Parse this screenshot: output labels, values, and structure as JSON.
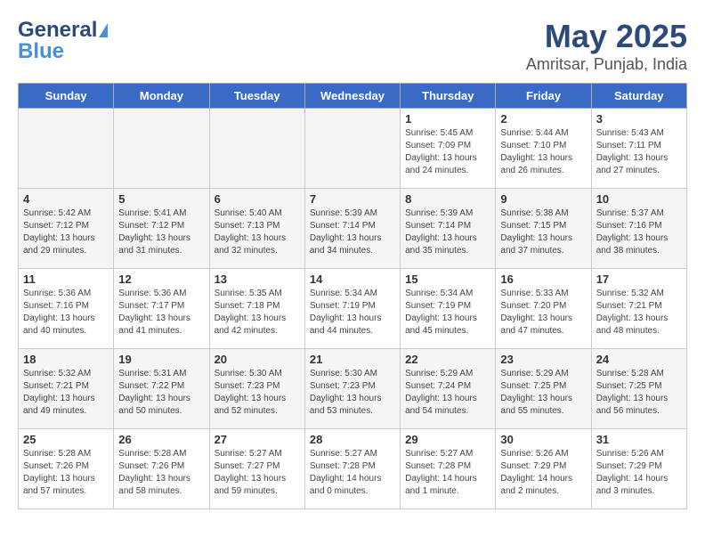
{
  "header": {
    "logo_general": "General",
    "logo_blue": "Blue",
    "title": "May 2025",
    "subtitle": "Amritsar, Punjab, India"
  },
  "days_of_week": [
    "Sunday",
    "Monday",
    "Tuesday",
    "Wednesday",
    "Thursday",
    "Friday",
    "Saturday"
  ],
  "weeks": [
    [
      {
        "day": "",
        "empty": true
      },
      {
        "day": "",
        "empty": true
      },
      {
        "day": "",
        "empty": true
      },
      {
        "day": "",
        "empty": true
      },
      {
        "day": "1",
        "sunrise": "5:45 AM",
        "sunset": "7:09 PM",
        "daylight": "13 hours and 24 minutes."
      },
      {
        "day": "2",
        "sunrise": "5:44 AM",
        "sunset": "7:10 PM",
        "daylight": "13 hours and 26 minutes."
      },
      {
        "day": "3",
        "sunrise": "5:43 AM",
        "sunset": "7:11 PM",
        "daylight": "13 hours and 27 minutes."
      }
    ],
    [
      {
        "day": "4",
        "sunrise": "5:42 AM",
        "sunset": "7:12 PM",
        "daylight": "13 hours and 29 minutes."
      },
      {
        "day": "5",
        "sunrise": "5:41 AM",
        "sunset": "7:12 PM",
        "daylight": "13 hours and 31 minutes."
      },
      {
        "day": "6",
        "sunrise": "5:40 AM",
        "sunset": "7:13 PM",
        "daylight": "13 hours and 32 minutes."
      },
      {
        "day": "7",
        "sunrise": "5:39 AM",
        "sunset": "7:14 PM",
        "daylight": "13 hours and 34 minutes."
      },
      {
        "day": "8",
        "sunrise": "5:39 AM",
        "sunset": "7:14 PM",
        "daylight": "13 hours and 35 minutes."
      },
      {
        "day": "9",
        "sunrise": "5:38 AM",
        "sunset": "7:15 PM",
        "daylight": "13 hours and 37 minutes."
      },
      {
        "day": "10",
        "sunrise": "5:37 AM",
        "sunset": "7:16 PM",
        "daylight": "13 hours and 38 minutes."
      }
    ],
    [
      {
        "day": "11",
        "sunrise": "5:36 AM",
        "sunset": "7:16 PM",
        "daylight": "13 hours and 40 minutes."
      },
      {
        "day": "12",
        "sunrise": "5:36 AM",
        "sunset": "7:17 PM",
        "daylight": "13 hours and 41 minutes."
      },
      {
        "day": "13",
        "sunrise": "5:35 AM",
        "sunset": "7:18 PM",
        "daylight": "13 hours and 42 minutes."
      },
      {
        "day": "14",
        "sunrise": "5:34 AM",
        "sunset": "7:19 PM",
        "daylight": "13 hours and 44 minutes."
      },
      {
        "day": "15",
        "sunrise": "5:34 AM",
        "sunset": "7:19 PM",
        "daylight": "13 hours and 45 minutes."
      },
      {
        "day": "16",
        "sunrise": "5:33 AM",
        "sunset": "7:20 PM",
        "daylight": "13 hours and 47 minutes."
      },
      {
        "day": "17",
        "sunrise": "5:32 AM",
        "sunset": "7:21 PM",
        "daylight": "13 hours and 48 minutes."
      }
    ],
    [
      {
        "day": "18",
        "sunrise": "5:32 AM",
        "sunset": "7:21 PM",
        "daylight": "13 hours and 49 minutes."
      },
      {
        "day": "19",
        "sunrise": "5:31 AM",
        "sunset": "7:22 PM",
        "daylight": "13 hours and 50 minutes."
      },
      {
        "day": "20",
        "sunrise": "5:30 AM",
        "sunset": "7:23 PM",
        "daylight": "13 hours and 52 minutes."
      },
      {
        "day": "21",
        "sunrise": "5:30 AM",
        "sunset": "7:23 PM",
        "daylight": "13 hours and 53 minutes."
      },
      {
        "day": "22",
        "sunrise": "5:29 AM",
        "sunset": "7:24 PM",
        "daylight": "13 hours and 54 minutes."
      },
      {
        "day": "23",
        "sunrise": "5:29 AM",
        "sunset": "7:25 PM",
        "daylight": "13 hours and 55 minutes."
      },
      {
        "day": "24",
        "sunrise": "5:28 AM",
        "sunset": "7:25 PM",
        "daylight": "13 hours and 56 minutes."
      }
    ],
    [
      {
        "day": "25",
        "sunrise": "5:28 AM",
        "sunset": "7:26 PM",
        "daylight": "13 hours and 57 minutes."
      },
      {
        "day": "26",
        "sunrise": "5:28 AM",
        "sunset": "7:26 PM",
        "daylight": "13 hours and 58 minutes."
      },
      {
        "day": "27",
        "sunrise": "5:27 AM",
        "sunset": "7:27 PM",
        "daylight": "13 hours and 59 minutes."
      },
      {
        "day": "28",
        "sunrise": "5:27 AM",
        "sunset": "7:28 PM",
        "daylight": "14 hours and 0 minutes."
      },
      {
        "day": "29",
        "sunrise": "5:27 AM",
        "sunset": "7:28 PM",
        "daylight": "14 hours and 1 minute."
      },
      {
        "day": "30",
        "sunrise": "5:26 AM",
        "sunset": "7:29 PM",
        "daylight": "14 hours and 2 minutes."
      },
      {
        "day": "31",
        "sunrise": "5:26 AM",
        "sunset": "7:29 PM",
        "daylight": "14 hours and 3 minutes."
      }
    ]
  ],
  "labels": {
    "sunrise": "Sunrise:",
    "sunset": "Sunset:",
    "daylight": "Daylight:"
  }
}
